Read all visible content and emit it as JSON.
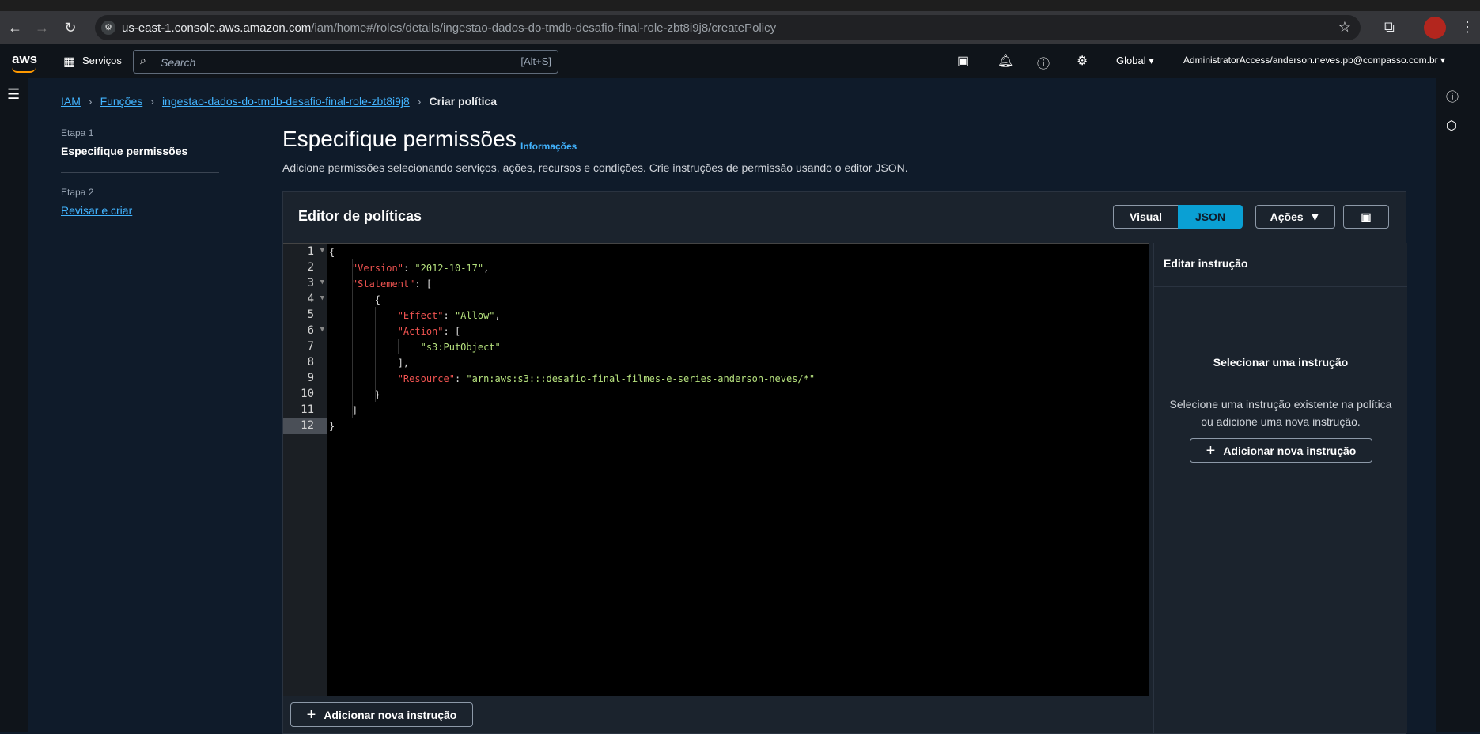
{
  "browser": {
    "url_host": "us-east-1.console.aws.amazon.com",
    "url_path": "/iam/home#/roles/details/ingestao-dados-do-tmdb-desafio-final-role-zbt8i9j8/createPolicy"
  },
  "aws_nav": {
    "logo": "aws",
    "services": "Serviços",
    "search_placeholder": "Search",
    "search_hint": "[Alt+S]",
    "region": "Global",
    "account": "AdministratorAccess/anderson.neves.pb@compasso.com.br"
  },
  "breadcrumb": {
    "items": [
      "IAM",
      "Funções",
      "ingestao-dados-do-tmdb-desafio-final-role-zbt8i9j8"
    ],
    "current": "Criar política"
  },
  "steps": {
    "step1_label": "Etapa 1",
    "step1_title": "Especifique permissões",
    "step2_label": "Etapa 2",
    "step2_title": "Revisar e criar"
  },
  "page": {
    "title": "Especifique permissões",
    "info": "Informações",
    "subtitle": "Adicione permissões selecionando serviços, ações, recursos e condições. Crie instruções de permissão usando o editor JSON."
  },
  "editor": {
    "title": "Editor de políticas",
    "btn_visual": "Visual",
    "btn_json": "JSON",
    "btn_acoes": "Ações",
    "line_numbers": [
      "1",
      "2",
      "3",
      "4",
      "5",
      "6",
      "7",
      "8",
      "9",
      "10",
      "11",
      "12"
    ],
    "code": {
      "l1": "{",
      "l2_key": "\"Version\"",
      "l2_val": "\"2012-10-17\"",
      "l3_key": "\"Statement\"",
      "l3_rest": ": [",
      "l4": "{",
      "l5_key": "\"Effect\"",
      "l5_val": "\"Allow\"",
      "l6_key": "\"Action\"",
      "l6_rest": ": [",
      "l7_val": "\"s3:PutObject\"",
      "l8": "],",
      "l9_key": "\"Resource\"",
      "l9_val": "\"arn:aws:s3:::desafio-final-filmes-e-series-anderson-neves/*\"",
      "l10": "}",
      "l11": "]",
      "l12": "}"
    },
    "add_statement": "Adicionar nova instrução"
  },
  "side_panel": {
    "title": "Editar instrução",
    "heading": "Selecionar uma instrução",
    "description": "Selecione uma instrução existente na política ou adicione uma nova instrução.",
    "add_statement": "Adicionar nova instrução"
  },
  "colors": {
    "accent": "#42b4ff",
    "json_key": "#ef5350",
    "json_string": "#b5e07d",
    "json_button": "#0aa0d4"
  }
}
